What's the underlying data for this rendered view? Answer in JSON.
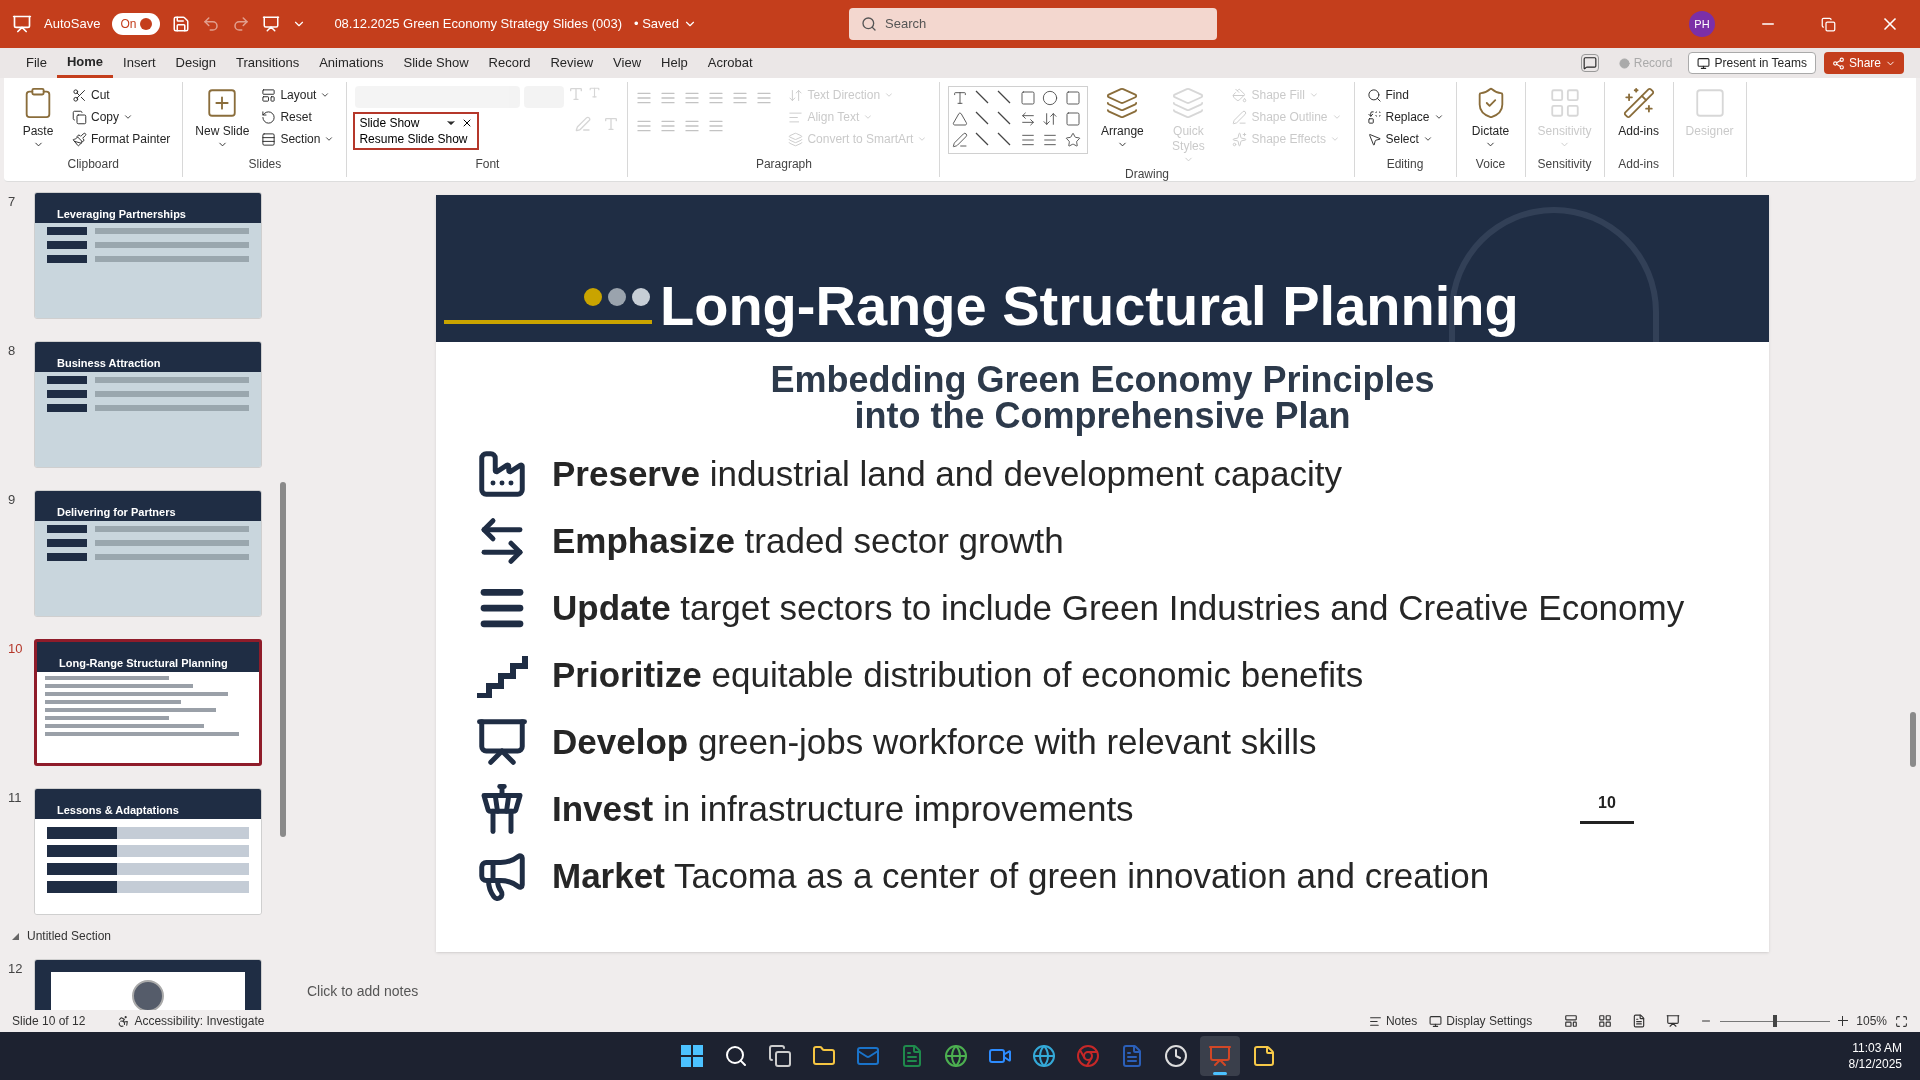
{
  "title_bar": {
    "autosave_label": "AutoSave",
    "autosave_toggle": {
      "label": "On",
      "on": true
    },
    "document_title": "08.12.2025 Green Economy Strategy Slides (003)",
    "save_status": "• Saved",
    "search": {
      "placeholder": "Search"
    },
    "avatar": "PH"
  },
  "menu_tabs": [
    {
      "label": "File",
      "selected": false
    },
    {
      "label": "Home",
      "selected": true
    },
    {
      "label": "Insert",
      "selected": false
    },
    {
      "label": "Design",
      "selected": false
    },
    {
      "label": "Transitions",
      "selected": false
    },
    {
      "label": "Animations",
      "selected": false
    },
    {
      "label": "Slide Show",
      "selected": false
    },
    {
      "label": "Record",
      "selected": false
    },
    {
      "label": "Review",
      "selected": false
    },
    {
      "label": "View",
      "selected": false
    },
    {
      "label": "Help",
      "selected": false
    },
    {
      "label": "Acrobat",
      "selected": false
    }
  ],
  "menu_actions": [
    {
      "kind": "record",
      "label": "Record",
      "disabled": true
    },
    {
      "kind": "teams",
      "label": "Present in Teams",
      "disabled": false
    },
    {
      "kind": "share",
      "label": "Share",
      "disabled": false
    }
  ],
  "ribbon_groups": [
    {
      "label": "Clipboard",
      "items": [
        {
          "kind": "large",
          "label": "Paste",
          "disabled": false,
          "dropdown": true
        },
        {
          "kind": "small",
          "label": "Cut",
          "disabled": false,
          "dropdown": false
        },
        {
          "kind": "small",
          "label": "Copy",
          "disabled": false,
          "dropdown": true
        },
        {
          "kind": "small",
          "label": "Format Painter",
          "disabled": false,
          "dropdown": false
        }
      ]
    },
    {
      "label": "Slides",
      "items": [
        {
          "kind": "large",
          "label": "New Slide",
          "disabled": false,
          "dropdown": true
        },
        {
          "kind": "small",
          "label": "Layout",
          "disabled": false,
          "dropdown": true
        },
        {
          "kind": "small",
          "label": "Reset",
          "disabled": false,
          "dropdown": false
        },
        {
          "kind": "small",
          "label": "Section",
          "disabled": false,
          "dropdown": true
        }
      ]
    },
    {
      "label": "Font",
      "items": [
        {
          "kind": "font",
          "disabled": true
        }
      ]
    },
    {
      "label": "Paragraph",
      "items": [
        {
          "kind": "paragraph",
          "disabled": true
        },
        {
          "kind": "small",
          "label": "Text Direction",
          "disabled": true,
          "dropdown": true
        },
        {
          "kind": "small",
          "label": "Align Text",
          "disabled": true,
          "dropdown": true
        },
        {
          "kind": "small",
          "label": "Convert to SmartArt",
          "disabled": true,
          "dropdown": true
        }
      ]
    },
    {
      "label": "Drawing",
      "items": [
        {
          "kind": "gallery"
        },
        {
          "kind": "large",
          "label": "Arrange",
          "disabled": false,
          "dropdown": true
        },
        {
          "kind": "large",
          "label": "Quick Styles",
          "disabled": true,
          "dropdown": true
        },
        {
          "kind": "small",
          "label": "Shape Fill",
          "disabled": true,
          "dropdown": true
        },
        {
          "kind": "small",
          "label": "Shape Outline",
          "disabled": true,
          "dropdown": true
        },
        {
          "kind": "small",
          "label": "Shape Effects",
          "disabled": true,
          "dropdown": true
        }
      ]
    },
    {
      "label": "Editing",
      "items": [
        {
          "kind": "small",
          "label": "Find",
          "disabled": false,
          "dropdown": false
        },
        {
          "kind": "small",
          "label": "Replace",
          "disabled": false,
          "dropdown": true
        },
        {
          "kind": "small",
          "label": "Select",
          "disabled": false,
          "dropdown": true
        }
      ]
    },
    {
      "label": "Voice",
      "items": [
        {
          "kind": "large",
          "label": "Dictate",
          "disabled": false,
          "dropdown": true
        }
      ]
    },
    {
      "label": "Sensitivity",
      "items": [
        {
          "kind": "large",
          "label": "Sensitivity",
          "disabled": true,
          "dropdown": true
        }
      ]
    },
    {
      "label": "Add-ins",
      "items": [
        {
          "kind": "large",
          "label": "Add-ins",
          "disabled": false,
          "dropdown": false
        }
      ]
    },
    {
      "items": [
        {
          "kind": "large",
          "label": "Designer",
          "disabled": true,
          "dropdown": false
        }
      ]
    }
  ],
  "slide_show_popup": {
    "title": "Slide Show",
    "action": "Resume Slide Show"
  },
  "thumbnails": [
    {
      "number": "7",
      "title": "Leveraging Partnerships",
      "kind": "focus",
      "selected": false
    },
    {
      "number": "8",
      "title": "Business Attraction",
      "kind": "focus",
      "selected": false
    },
    {
      "number": "9",
      "title": "Delivering for Partners",
      "kind": "focus",
      "selected": false
    },
    {
      "number": "10",
      "title": "Long-Range Structural Planning",
      "kind": "list",
      "selected": true
    },
    {
      "number": "11",
      "title": "Lessons & Adaptations",
      "kind": "arrows",
      "selected": false
    },
    {
      "section": "Untitled Section"
    },
    {
      "number": "12",
      "kind": "closing",
      "selected": false
    }
  ],
  "slide": {
    "title": "Long-Range Structural Planning",
    "subtitle": [
      "Embedding Green Economy Principles",
      "into the Comprehensive Plan"
    ],
    "bullets": [
      {
        "kind": "factory",
        "bold": "Preserve",
        "text": "industrial land and development capacity"
      },
      {
        "kind": "arrows",
        "bold": "Emphasize",
        "text": "traded sector growth"
      },
      {
        "kind": "lines",
        "bold": "Update",
        "text": "target sectors to include Green Industries and Creative Economy"
      },
      {
        "kind": "stairs",
        "bold": "Prioritize",
        "text": "equitable distribution of economic benefits"
      },
      {
        "kind": "teacher",
        "bold": "Develop",
        "text": "green-jobs workforce with relevant skills"
      },
      {
        "kind": "tower",
        "bold": "Invest",
        "text": "in infrastructure improvements"
      },
      {
        "kind": "megaphone",
        "bold": "Market",
        "text": "Tacoma as a center of green innovation and creation"
      }
    ],
    "page_number": "10"
  },
  "notes_placeholder": "Click to add notes",
  "status_bar": {
    "slide_position": "Slide 10 of 12",
    "accessibility": "Accessibility: Investigate",
    "notes": "Notes",
    "display_settings": "Display Settings",
    "zoom": "105%",
    "zoom_slider": {
      "level": 0.5
    }
  },
  "taskbar": {
    "apps": [
      {
        "kind": "start",
        "selected": false
      },
      {
        "kind": "search",
        "selected": false
      },
      {
        "kind": "taskview",
        "selected": false
      },
      {
        "kind": "explorer",
        "selected": false
      },
      {
        "kind": "outlook",
        "selected": false
      },
      {
        "kind": "excel",
        "selected": false
      },
      {
        "kind": "globe",
        "selected": false
      },
      {
        "kind": "zoom",
        "selected": false
      },
      {
        "kind": "edge",
        "selected": false
      },
      {
        "kind": "chrome",
        "selected": false
      },
      {
        "kind": "word",
        "selected": false
      },
      {
        "kind": "clock",
        "selected": false
      },
      {
        "kind": "powerpoint",
        "selected": true
      },
      {
        "kind": "notes",
        "selected": false
      }
    ],
    "time": "11:03 AM",
    "date": "8/12/2025"
  }
}
